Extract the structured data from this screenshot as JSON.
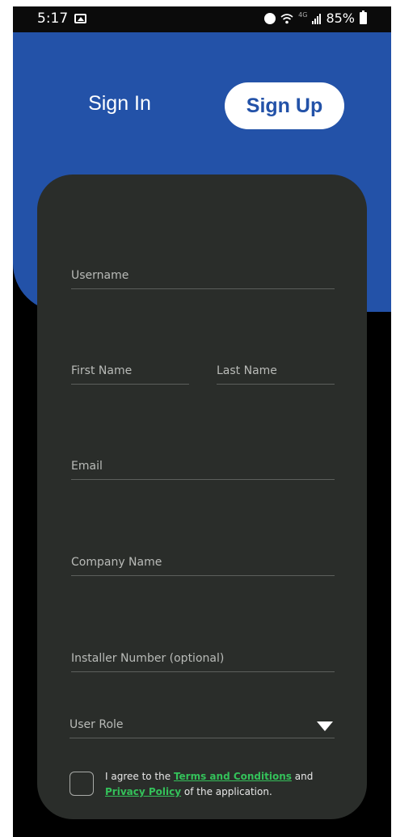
{
  "status_bar": {
    "time": "5:17",
    "network": "4G",
    "battery": "85%"
  },
  "tabs": {
    "sign_in": "Sign In",
    "sign_up": "Sign Up"
  },
  "form": {
    "username_placeholder": "Username",
    "first_name_placeholder": "First Name",
    "last_name_placeholder": "Last Name",
    "email_placeholder": "Email",
    "company_placeholder": "Company Name",
    "installer_placeholder": "Installer Number (optional)",
    "user_role_label": "User Role",
    "agree_prefix": "I agree to the ",
    "terms_link": "Terms and Conditions",
    "agree_and": " and ",
    "privacy_link": "Privacy Policy",
    "agree_suffix": "  of the application."
  },
  "colors": {
    "header_blue": "#2352a8",
    "card_bg": "#2a2d2a",
    "link_green": "#34c15a"
  }
}
